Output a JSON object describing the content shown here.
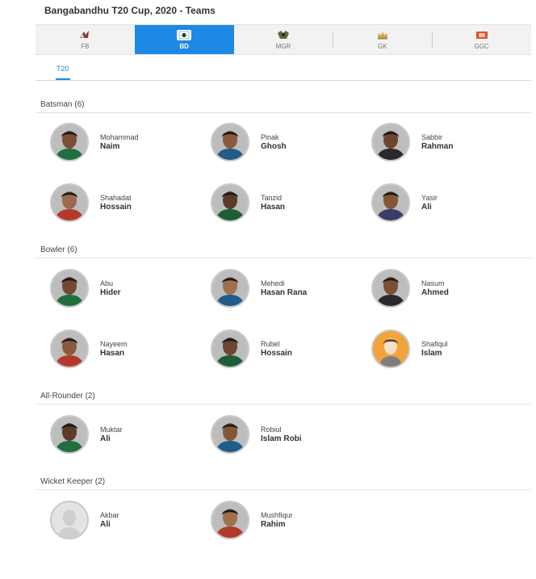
{
  "page": {
    "title": "Bangabandhu T20 Cup, 2020 - Teams"
  },
  "team_tabs": [
    {
      "label": "FB",
      "icon": "fb-team-logo-icon"
    },
    {
      "label": "BD",
      "icon": "bd-team-logo-icon",
      "active": true
    },
    {
      "label": "MGR",
      "icon": "mgr-team-logo-icon"
    },
    {
      "label": "GK",
      "icon": "gk-team-logo-icon"
    },
    {
      "label": "GGC",
      "icon": "ggc-team-logo-icon"
    }
  ],
  "format_tabs": [
    {
      "label": "T20",
      "active": true
    }
  ],
  "sections": [
    {
      "title": "Batsman (6)",
      "players": [
        {
          "first": "Mohammad",
          "last": "Naim"
        },
        {
          "first": "Pinak",
          "last": "Ghosh"
        },
        {
          "first": "Sabbir",
          "last": "Rahman"
        },
        {
          "first": "Shahadat",
          "last": "Hossain"
        },
        {
          "first": "Tanzid",
          "last": "Hasan"
        },
        {
          "first": "Yasir",
          "last": "Ali"
        }
      ]
    },
    {
      "title": "Bowler (6)",
      "players": [
        {
          "first": "Abu",
          "last": "Hider"
        },
        {
          "first": "Mehedi",
          "last": "Hasan Rana"
        },
        {
          "first": "Nasum",
          "last": "Ahmed"
        },
        {
          "first": "Nayeem",
          "last": "Hasan"
        },
        {
          "first": "Rubel",
          "last": "Hossain"
        },
        {
          "first": "Shafiqul",
          "last": "Islam"
        }
      ]
    },
    {
      "title": "All-Rounder (2)",
      "players": [
        {
          "first": "Muktar",
          "last": "Ali"
        },
        {
          "first": "Robiul",
          "last": "Islam Robi"
        }
      ]
    },
    {
      "title": "Wicket Keeper (2)",
      "players": [
        {
          "first": "Akbar",
          "last": "Ali"
        },
        {
          "first": "Mushfiqur",
          "last": "Rahim"
        }
      ]
    }
  ],
  "colors": {
    "accent": "#1e88e5",
    "tab_bar": "#f2f2f2",
    "placeholder_orange": "#f2a33a",
    "placeholder_grey": "#e4e4e4"
  }
}
